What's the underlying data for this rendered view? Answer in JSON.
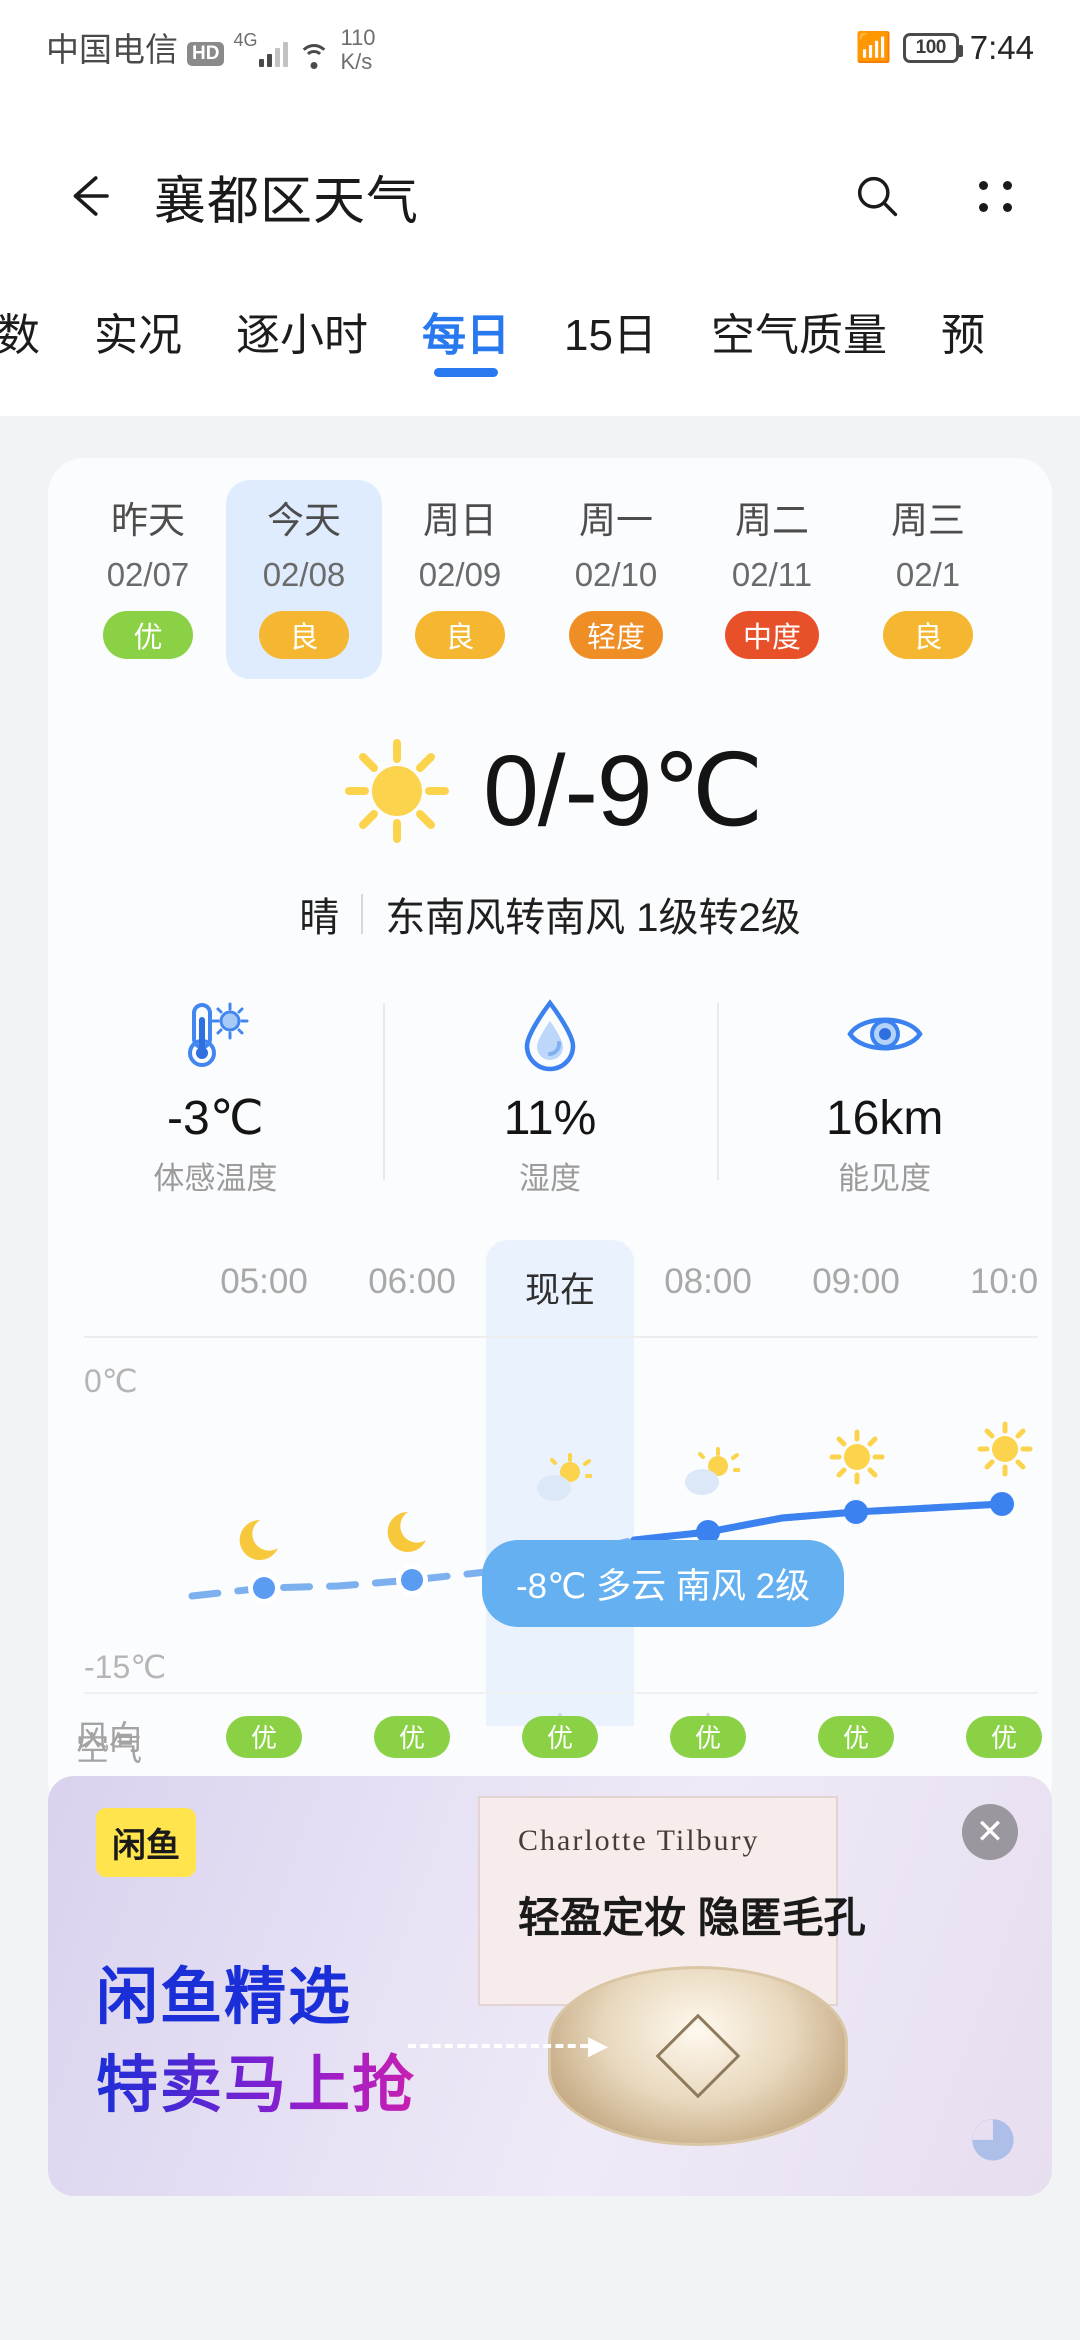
{
  "status_bar": {
    "carrier": "中国电信",
    "hd_badge": "HD",
    "network_type": "4G",
    "net_speed_value": "110",
    "net_speed_unit": "K/s",
    "battery_level": "100",
    "time": "7:44",
    "icons": [
      "hd-icon",
      "signal-bars-icon",
      "wifi-icon",
      "vibrate-icon",
      "battery-icon"
    ]
  },
  "app_bar": {
    "back_icon": "back-arrow-icon",
    "title": "襄都区天气",
    "search_icon": "search-icon",
    "more_icon": "more-options-icon"
  },
  "tabs": {
    "items": [
      {
        "label": "指数",
        "active": false
      },
      {
        "label": "实况",
        "active": false
      },
      {
        "label": "逐小时",
        "active": false
      },
      {
        "label": "每日",
        "active": true
      },
      {
        "label": "15日",
        "active": false
      },
      {
        "label": "空气质量",
        "active": false
      },
      {
        "label": "预",
        "active": false
      }
    ],
    "active_color": "#2878f0"
  },
  "days": [
    {
      "name": "昨天",
      "date": "02/07",
      "aqi": "优",
      "aqi_color": "#8bd145",
      "selected": false
    },
    {
      "name": "今天",
      "date": "02/08",
      "aqi": "良",
      "aqi_color": "#f5b731",
      "selected": true
    },
    {
      "name": "周日",
      "date": "02/09",
      "aqi": "良",
      "aqi_color": "#f5b731",
      "selected": false
    },
    {
      "name": "周一",
      "date": "02/10",
      "aqi": "轻度",
      "aqi_color": "#ef8e25",
      "selected": false
    },
    {
      "name": "周二",
      "date": "02/11",
      "aqi": "中度",
      "aqi_color": "#e8502a",
      "selected": false
    },
    {
      "name": "周三",
      "date": "02/1",
      "aqi": "良",
      "aqi_color": "#f5b731",
      "selected": false
    }
  ],
  "summary": {
    "weather_icon": "sun-icon",
    "temperature_range": "0/-9℃",
    "condition": "晴",
    "wind": "东南风转南风 1级转2级"
  },
  "metrics": [
    {
      "icon": "feels-like-thermometer-icon",
      "value": "-3℃",
      "label": "体感温度"
    },
    {
      "icon": "humidity-droplet-icon",
      "value": "11%",
      "label": "湿度"
    },
    {
      "icon": "visibility-eye-icon",
      "value": "16km",
      "label": "能见度"
    }
  ],
  "hourly": {
    "axis_top_label": "0℃",
    "axis_bottom_label": "-15℃",
    "wind_row_label": "风向",
    "air_row_label": "空气",
    "tooltip": "-8℃ 多云 南风 2级",
    "tooltip_bg": "#65b0f0",
    "columns": [
      {
        "time": "05:00",
        "is_now": false,
        "weather_icon": "moon-icon",
        "temp": -11,
        "wind_icon": "wind-arrow-icon",
        "aqi": "优"
      },
      {
        "time": "06:00",
        "is_now": false,
        "weather_icon": "moon-icon",
        "temp": -11,
        "wind_icon": "wind-arrow-icon",
        "aqi": "优"
      },
      {
        "time": "现在",
        "is_now": true,
        "weather_icon": "sun-cloud-icon",
        "temp": -10,
        "wind_icon": "wind-arrow-icon",
        "aqi": "优"
      },
      {
        "time": "08:00",
        "is_now": false,
        "weather_icon": "sun-cloud-icon",
        "temp": -9,
        "wind_icon": "wind-arrow-icon",
        "aqi": "优"
      },
      {
        "time": "09:00",
        "is_now": false,
        "weather_icon": "sun-icon",
        "temp": -7,
        "wind_icon": "wind-arrow-icon",
        "aqi": "优"
      },
      {
        "time": "10:0",
        "is_now": false,
        "weather_icon": "sun-icon",
        "temp": -6,
        "wind_icon": "wind-arrow-icon",
        "aqi": "优"
      }
    ],
    "aqi_chip_color": "#8bd145"
  },
  "ad": {
    "logo": "闲鱼",
    "close_icon": "close-icon",
    "title_line1": "闲鱼精选",
    "title_line2": "特卖马上抢",
    "brand": "Charlotte Tilbury",
    "subtitle": "轻盈定妆 隐匿毛孔"
  }
}
